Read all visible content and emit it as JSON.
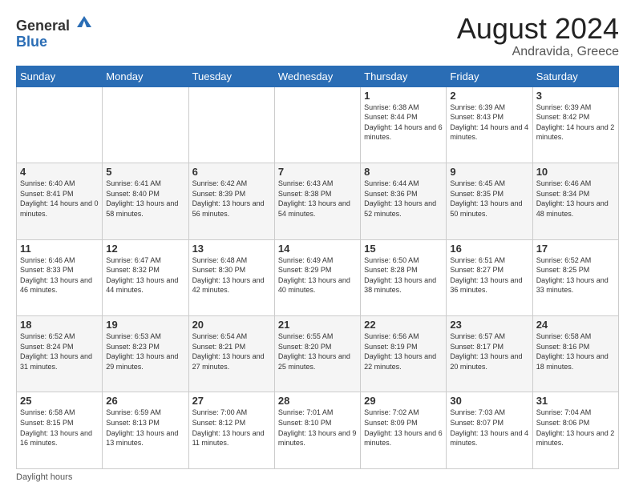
{
  "header": {
    "logo_general": "General",
    "logo_blue": "Blue",
    "month_year": "August 2024",
    "location": "Andravida, Greece"
  },
  "footer": {
    "daylight_label": "Daylight hours"
  },
  "days_of_week": [
    "Sunday",
    "Monday",
    "Tuesday",
    "Wednesday",
    "Thursday",
    "Friday",
    "Saturday"
  ],
  "weeks": [
    [
      {
        "day": "",
        "sunrise": "",
        "sunset": "",
        "daylight": ""
      },
      {
        "day": "",
        "sunrise": "",
        "sunset": "",
        "daylight": ""
      },
      {
        "day": "",
        "sunrise": "",
        "sunset": "",
        "daylight": ""
      },
      {
        "day": "",
        "sunrise": "",
        "sunset": "",
        "daylight": ""
      },
      {
        "day": "1",
        "sunrise": "6:38 AM",
        "sunset": "8:44 PM",
        "daylight": "14 hours and 6 minutes."
      },
      {
        "day": "2",
        "sunrise": "6:39 AM",
        "sunset": "8:43 PM",
        "daylight": "14 hours and 4 minutes."
      },
      {
        "day": "3",
        "sunrise": "6:39 AM",
        "sunset": "8:42 PM",
        "daylight": "14 hours and 2 minutes."
      }
    ],
    [
      {
        "day": "4",
        "sunrise": "6:40 AM",
        "sunset": "8:41 PM",
        "daylight": "14 hours and 0 minutes."
      },
      {
        "day": "5",
        "sunrise": "6:41 AM",
        "sunset": "8:40 PM",
        "daylight": "13 hours and 58 minutes."
      },
      {
        "day": "6",
        "sunrise": "6:42 AM",
        "sunset": "8:39 PM",
        "daylight": "13 hours and 56 minutes."
      },
      {
        "day": "7",
        "sunrise": "6:43 AM",
        "sunset": "8:38 PM",
        "daylight": "13 hours and 54 minutes."
      },
      {
        "day": "8",
        "sunrise": "6:44 AM",
        "sunset": "8:36 PM",
        "daylight": "13 hours and 52 minutes."
      },
      {
        "day": "9",
        "sunrise": "6:45 AM",
        "sunset": "8:35 PM",
        "daylight": "13 hours and 50 minutes."
      },
      {
        "day": "10",
        "sunrise": "6:46 AM",
        "sunset": "8:34 PM",
        "daylight": "13 hours and 48 minutes."
      }
    ],
    [
      {
        "day": "11",
        "sunrise": "6:46 AM",
        "sunset": "8:33 PM",
        "daylight": "13 hours and 46 minutes."
      },
      {
        "day": "12",
        "sunrise": "6:47 AM",
        "sunset": "8:32 PM",
        "daylight": "13 hours and 44 minutes."
      },
      {
        "day": "13",
        "sunrise": "6:48 AM",
        "sunset": "8:30 PM",
        "daylight": "13 hours and 42 minutes."
      },
      {
        "day": "14",
        "sunrise": "6:49 AM",
        "sunset": "8:29 PM",
        "daylight": "13 hours and 40 minutes."
      },
      {
        "day": "15",
        "sunrise": "6:50 AM",
        "sunset": "8:28 PM",
        "daylight": "13 hours and 38 minutes."
      },
      {
        "day": "16",
        "sunrise": "6:51 AM",
        "sunset": "8:27 PM",
        "daylight": "13 hours and 36 minutes."
      },
      {
        "day": "17",
        "sunrise": "6:52 AM",
        "sunset": "8:25 PM",
        "daylight": "13 hours and 33 minutes."
      }
    ],
    [
      {
        "day": "18",
        "sunrise": "6:52 AM",
        "sunset": "8:24 PM",
        "daylight": "13 hours and 31 minutes."
      },
      {
        "day": "19",
        "sunrise": "6:53 AM",
        "sunset": "8:23 PM",
        "daylight": "13 hours and 29 minutes."
      },
      {
        "day": "20",
        "sunrise": "6:54 AM",
        "sunset": "8:21 PM",
        "daylight": "13 hours and 27 minutes."
      },
      {
        "day": "21",
        "sunrise": "6:55 AM",
        "sunset": "8:20 PM",
        "daylight": "13 hours and 25 minutes."
      },
      {
        "day": "22",
        "sunrise": "6:56 AM",
        "sunset": "8:19 PM",
        "daylight": "13 hours and 22 minutes."
      },
      {
        "day": "23",
        "sunrise": "6:57 AM",
        "sunset": "8:17 PM",
        "daylight": "13 hours and 20 minutes."
      },
      {
        "day": "24",
        "sunrise": "6:58 AM",
        "sunset": "8:16 PM",
        "daylight": "13 hours and 18 minutes."
      }
    ],
    [
      {
        "day": "25",
        "sunrise": "6:58 AM",
        "sunset": "8:15 PM",
        "daylight": "13 hours and 16 minutes."
      },
      {
        "day": "26",
        "sunrise": "6:59 AM",
        "sunset": "8:13 PM",
        "daylight": "13 hours and 13 minutes."
      },
      {
        "day": "27",
        "sunrise": "7:00 AM",
        "sunset": "8:12 PM",
        "daylight": "13 hours and 11 minutes."
      },
      {
        "day": "28",
        "sunrise": "7:01 AM",
        "sunset": "8:10 PM",
        "daylight": "13 hours and 9 minutes."
      },
      {
        "day": "29",
        "sunrise": "7:02 AM",
        "sunset": "8:09 PM",
        "daylight": "13 hours and 6 minutes."
      },
      {
        "day": "30",
        "sunrise": "7:03 AM",
        "sunset": "8:07 PM",
        "daylight": "13 hours and 4 minutes."
      },
      {
        "day": "31",
        "sunrise": "7:04 AM",
        "sunset": "8:06 PM",
        "daylight": "13 hours and 2 minutes."
      }
    ]
  ]
}
